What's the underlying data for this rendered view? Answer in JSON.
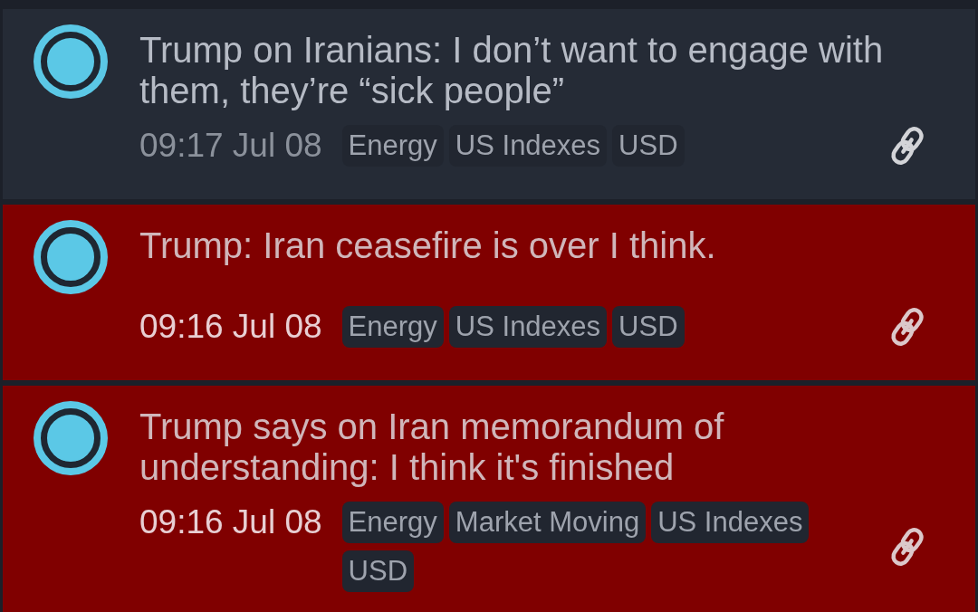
{
  "items": [
    {
      "highlighted": false,
      "headline": "Trump on Iranians: I don’t want to engage with them, they’re “sick people”",
      "time": "09:17 Jul 08",
      "tags": [
        "Energy",
        "US Indexes",
        "USD"
      ]
    },
    {
      "highlighted": true,
      "headline": "Trump: Iran ceasefire is over I think.",
      "time": "09:16 Jul 08",
      "tags": [
        "Energy",
        "US Indexes",
        "USD"
      ]
    },
    {
      "highlighted": true,
      "headline": "Trump says on Iran memorandum of understanding: I think it's finished",
      "time": "09:16 Jul 08",
      "tags": [
        "Energy",
        "Market Moving",
        "US Indexes",
        "USD"
      ]
    }
  ]
}
